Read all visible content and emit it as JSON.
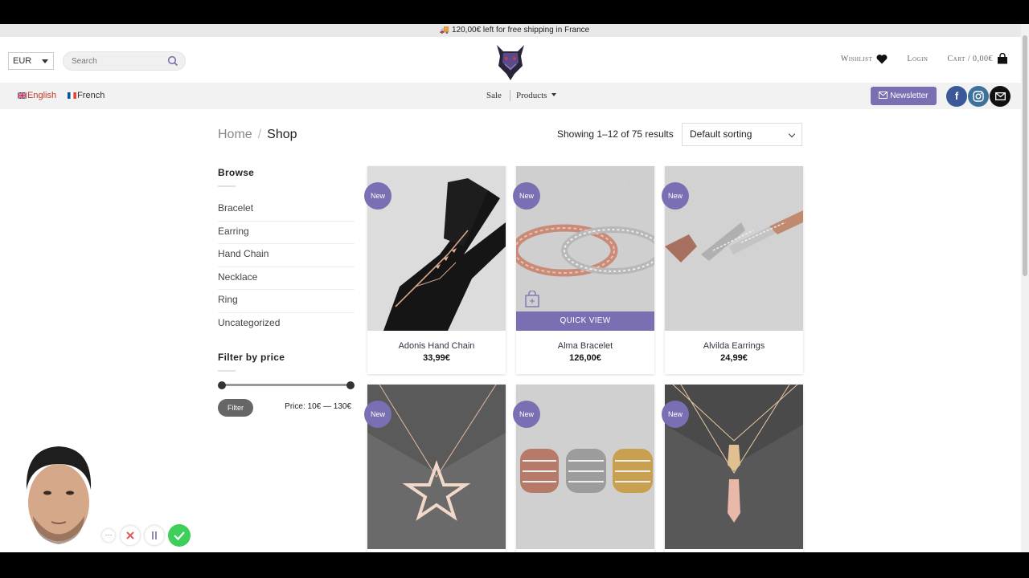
{
  "promo_bar": {
    "text": "🚚 120,00€ left for free shipping in France"
  },
  "header": {
    "currency": "EUR",
    "search_placeholder": "Search",
    "wishlist_label": "Wishlist",
    "login_label": "Login",
    "cart_label": "Cart / 0,00€"
  },
  "nav": {
    "languages": [
      {
        "label": "English",
        "active": true
      },
      {
        "label": "French",
        "active": false
      }
    ],
    "menu": [
      {
        "label": "Sale"
      },
      {
        "label": "Products"
      }
    ],
    "newsletter_label": "Newsletter",
    "social": [
      {
        "icon": "facebook-icon",
        "color": "#3b5998"
      },
      {
        "icon": "instagram-icon",
        "color": "#3f729b"
      },
      {
        "icon": "email-icon",
        "color": "#111111"
      }
    ]
  },
  "breadcrumb": {
    "home": "Home",
    "current": "Shop",
    "separator": "/"
  },
  "results_text": "Showing 1–12 of 75 results",
  "sorting": {
    "selected": "Default sorting"
  },
  "sidebar": {
    "browse_title": "Browse",
    "categories": [
      "Bracelet",
      "Earring",
      "Hand Chain",
      "Necklace",
      "Ring",
      "Uncategorized"
    ],
    "filter_title": "Filter by price",
    "filter_button": "Filter",
    "price_range_text": "Price: 10€ — 130€"
  },
  "products": [
    {
      "name": "Adonis Hand Chain",
      "price": "33,99€",
      "badge": "New"
    },
    {
      "name": "Alma Bracelet",
      "price": "126,00€",
      "badge": "New",
      "quick_view": "QUICK VIEW"
    },
    {
      "name": "Alvilda Earrings",
      "price": "24,99€",
      "badge": "New"
    },
    {
      "name": "",
      "price": "",
      "badge": "New"
    },
    {
      "name": "",
      "price": "",
      "badge": "New"
    },
    {
      "name": "",
      "price": "",
      "badge": "New"
    }
  ],
  "colors": {
    "accent": "#7b6fb3",
    "english_link": "#c0392b"
  },
  "recording_controls": [
    {
      "icon": "more-icon"
    },
    {
      "icon": "close-icon"
    },
    {
      "icon": "pause-icon"
    },
    {
      "icon": "check-icon"
    }
  ]
}
